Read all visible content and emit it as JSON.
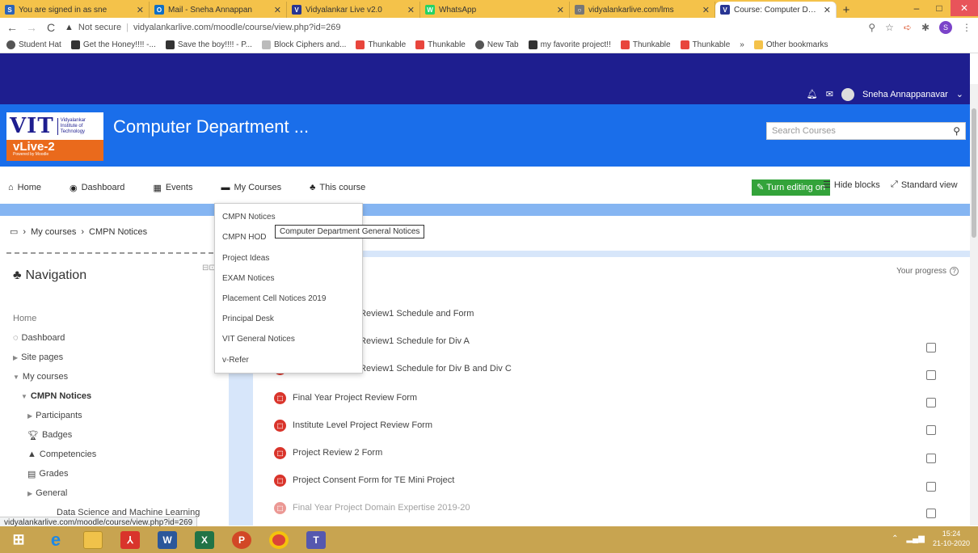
{
  "browser": {
    "tabs": [
      {
        "label": "You are signed in as sne",
        "icon_color": "#2c63b7",
        "icon_letter": "S",
        "active": false
      },
      {
        "label": "Mail - Sneha Annappan",
        "icon_color": "#0f6fc5",
        "icon_letter": "O",
        "active": false
      },
      {
        "label": "Vidyalankar Live v2.0",
        "icon_color": "#283593",
        "icon_letter": "V",
        "active": false
      },
      {
        "label": "WhatsApp",
        "icon_color": "#25d366",
        "icon_letter": "W",
        "active": false
      },
      {
        "label": "vidyalankarlive.com/lms",
        "icon_color": "#777777",
        "icon_letter": "○",
        "active": false
      },
      {
        "label": "Course: Computer Depa",
        "icon_color": "#283593",
        "icon_letter": "V",
        "active": true
      }
    ],
    "newtab": "+",
    "window_controls": {
      "minimize": "–",
      "maximize": "□",
      "close": "✕"
    },
    "address": {
      "security": "Not secure",
      "url": "vidyalankarlive.com/moodle/course/view.php?id=269"
    },
    "bookmarks": [
      {
        "label": "Student Hat",
        "color": "#555555"
      },
      {
        "label": "Get the Honey!!!! -...",
        "color": "#333333"
      },
      {
        "label": "Save the boy!!!! - P...",
        "color": "#333333"
      },
      {
        "label": "Block Ciphers and...",
        "color": "#999999"
      },
      {
        "label": "Thunkable",
        "color": "#e8453c"
      },
      {
        "label": "Thunkable",
        "color": "#e8453c"
      },
      {
        "label": "New Tab",
        "color": "#555555"
      },
      {
        "label": "my favorite project!!",
        "color": "#333333"
      },
      {
        "label": "Thunkable",
        "color": "#e8453c"
      },
      {
        "label": "Thunkable",
        "color": "#e8453c"
      }
    ],
    "bookmarks_more": "»",
    "other_bookmarks": "Other bookmarks",
    "profile_letter": "S"
  },
  "moodle": {
    "user_name": "Sneha Annappanavar",
    "logo": {
      "letters": "VIT",
      "sub": [
        "Vidyalankar",
        "Institute of",
        "Technology"
      ],
      "brand": "vLive-2",
      "tagline": "Powered by Moodle"
    },
    "course_title": "Computer Department ...",
    "search_placeholder": "Search Courses",
    "nav": {
      "home": "Home",
      "dashboard": "Dashboard",
      "events": "Events",
      "my_courses": "My Courses",
      "this_course": "This course",
      "turn_editing": "Turn editing on",
      "hide_blocks": "Hide blocks",
      "standard_view": "Standard view"
    },
    "breadcrumb": {
      "my_courses": "My courses",
      "current": "CMPN Notices"
    },
    "navigation_block": {
      "title": "Navigation",
      "items": {
        "home": "Home",
        "dashboard": "Dashboard",
        "site_pages": "Site pages",
        "my_courses": "My courses",
        "cmpn_notices": "CMPN Notices",
        "participants": "Participants",
        "badges": "Badges",
        "competencies": "Competencies",
        "grades": "Grades",
        "general": "General",
        "ds_ml": "Data Science and Machine Learning"
      }
    },
    "progress_label": "Your progress",
    "activities": [
      "t Review1 Schedule and Form",
      "t Review1 Schedule for Div A",
      "t Review1 Schedule for Div B and Div C",
      "Final Year Project Review Form",
      "Institute Level Project Review Form",
      "Project Review 2 Form",
      "Project Consent Form for TE Mini Project",
      "Final Year Project Domain Expertise 2019-20"
    ],
    "dropdown": [
      "CMPN Notices",
      "CMPN HOD",
      "Project Ideas",
      "EXAM Notices",
      "Placement Cell Notices 2019",
      "Principal Desk",
      "VIT General Notices",
      "v-Refer"
    ],
    "tooltip": "Computer Department General Notices"
  },
  "status_url": "vidyalankarlive.com/moodle/course/view.php?id=269",
  "taskbar": {
    "time": "15:24",
    "date": "21-10-2020"
  },
  "colors": {
    "brand_dark": "#1e1e8f",
    "header_blue": "#1a6eea",
    "orange": "#ea6a1c",
    "edit_green": "#33a33a",
    "pdf_red": "#d9342b"
  }
}
